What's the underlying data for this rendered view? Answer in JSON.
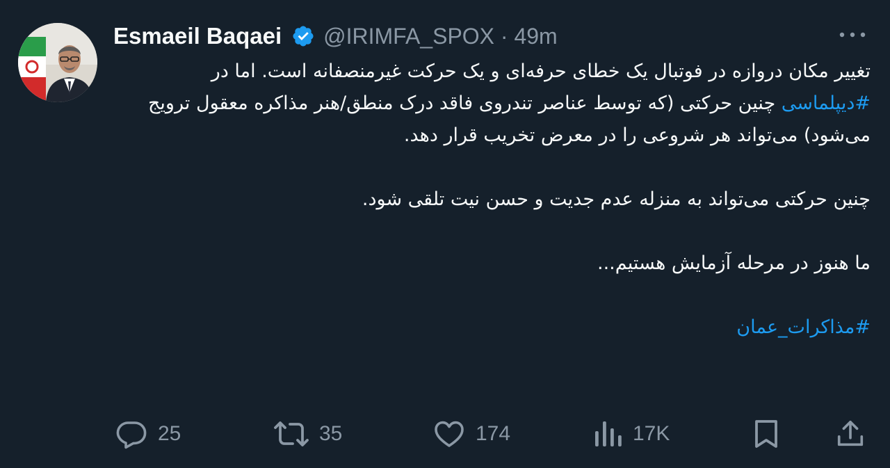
{
  "author": {
    "name": "Esmaeil Baqaei",
    "handle": "@IRIMFA_SPOX",
    "separator": "·",
    "time": "49m",
    "verified": true,
    "verified_color": "#1d9bf0"
  },
  "tweet": {
    "paragraph1_before": "تغییر مکان دروازه در فوتبال یک خطای حرفه‌ای و یک حرکت غیرمنصفانه است. اما در ",
    "paragraph1_hashtag": "#دیپلماسی",
    "paragraph1_after": " چنین حرکتی (که توسط عناصر تندروی فاقد درک منطق/هنر مذاکره معقول ترویج می‌شود) می‌تواند هر شروعی را در معرض تخریب قرار دهد.",
    "paragraph2": "چنین حرکتی می‌تواند به منزله عدم جدیت و حسن نیت تلقی شود.",
    "paragraph3": "ما هنوز در مرحله آزمایش هستیم...",
    "hashtag_footer": "#مذاکرات_عمان"
  },
  "actions": {
    "replies": "25",
    "retweets": "35",
    "likes": "174",
    "views": "17K"
  },
  "icons": {
    "more": "more-dots-icon",
    "reply": "reply-icon",
    "retweet": "retweet-icon",
    "like": "heart-icon",
    "views": "views-chart-icon",
    "bookmark": "bookmark-icon",
    "share": "share-icon"
  },
  "colors": {
    "background": "#15202b",
    "text": "#f7f9f9",
    "secondary": "#8b98a5",
    "link": "#1d9bf0"
  }
}
